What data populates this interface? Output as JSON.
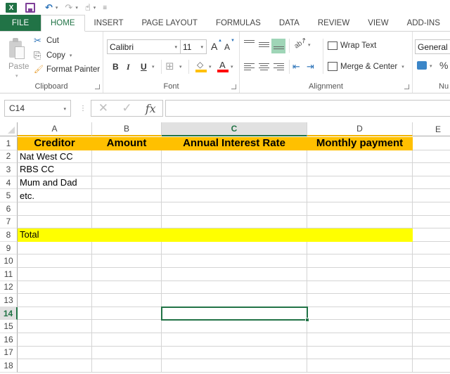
{
  "qat": {
    "app_icon": "excel-logo-icon",
    "app_icon_text": "X",
    "save": "save-icon",
    "undo": "undo-icon",
    "redo": "redo-icon",
    "touch": "touch-mode-icon",
    "customize": "customize-qat-icon",
    "undo_glyph": "↶",
    "redo_glyph": "↷",
    "touch_glyph": "☝",
    "customize_glyph": "≡",
    "caret": "▾"
  },
  "tabs": [
    {
      "label": "FILE"
    },
    {
      "label": "HOME"
    },
    {
      "label": "INSERT"
    },
    {
      "label": "PAGE LAYOUT"
    },
    {
      "label": "FORMULAS"
    },
    {
      "label": "DATA"
    },
    {
      "label": "REVIEW"
    },
    {
      "label": "VIEW"
    },
    {
      "label": "ADD-INS"
    }
  ],
  "active_tab": "HOME",
  "ribbon": {
    "clipboard": {
      "label": "Clipboard",
      "paste": "Paste",
      "cut": "Cut",
      "copy": "Copy",
      "format_painter": "Format Painter",
      "cut_glyph": "✂",
      "copy_glyph": "⎘",
      "painter_glyph": "🖌"
    },
    "font": {
      "label": "Font",
      "font_name": "Calibri",
      "font_size": "11",
      "grow": "A",
      "shrink": "A",
      "bold": "B",
      "italic": "I",
      "underline": "U",
      "borders_glyph": "⊞",
      "fill_glyph": "◇",
      "font_color": "A",
      "fill_color": "#ffc000",
      "font_color_hex": "#ff0000"
    },
    "alignment": {
      "label": "Alignment",
      "wrap_text": "Wrap Text",
      "merge_center": "Merge & Center",
      "orientation_glyph": "ab↗",
      "indent_dec_glyph": "⇤",
      "indent_inc_glyph": "⇥",
      "active_highlight": "#9fd5b7"
    },
    "number": {
      "label": "Nu",
      "format": "General",
      "percent": "%"
    },
    "dropdown_caret": "▾"
  },
  "formula_bar": {
    "name_box": "C14",
    "cancel_glyph": "✕",
    "enter_glyph": "✓",
    "fx_label": "fx",
    "separator": "⋮",
    "formula": ""
  },
  "sheet": {
    "columns": [
      "A",
      "B",
      "C",
      "D",
      "E"
    ],
    "selected_column": "C",
    "selected_row": "14",
    "active_cell": "C14",
    "rows": [
      "1",
      "2",
      "3",
      "4",
      "5",
      "6",
      "7",
      "8",
      "9",
      "10",
      "11",
      "12",
      "13",
      "14",
      "15",
      "16",
      "17",
      "18"
    ],
    "header_row": {
      "A": "Creditor",
      "B": "Amount",
      "C": "Annual Interest Rate",
      "D": "Monthly payment"
    },
    "cells": {
      "A2": "Nat West CC",
      "A3": "RBS CC",
      "A4": "Mum and Dad",
      "A5": "etc.",
      "A8": "Total"
    },
    "colors": {
      "header_fill": "#ffc000",
      "total_fill": "#ffff00",
      "selection": "#217346"
    }
  }
}
